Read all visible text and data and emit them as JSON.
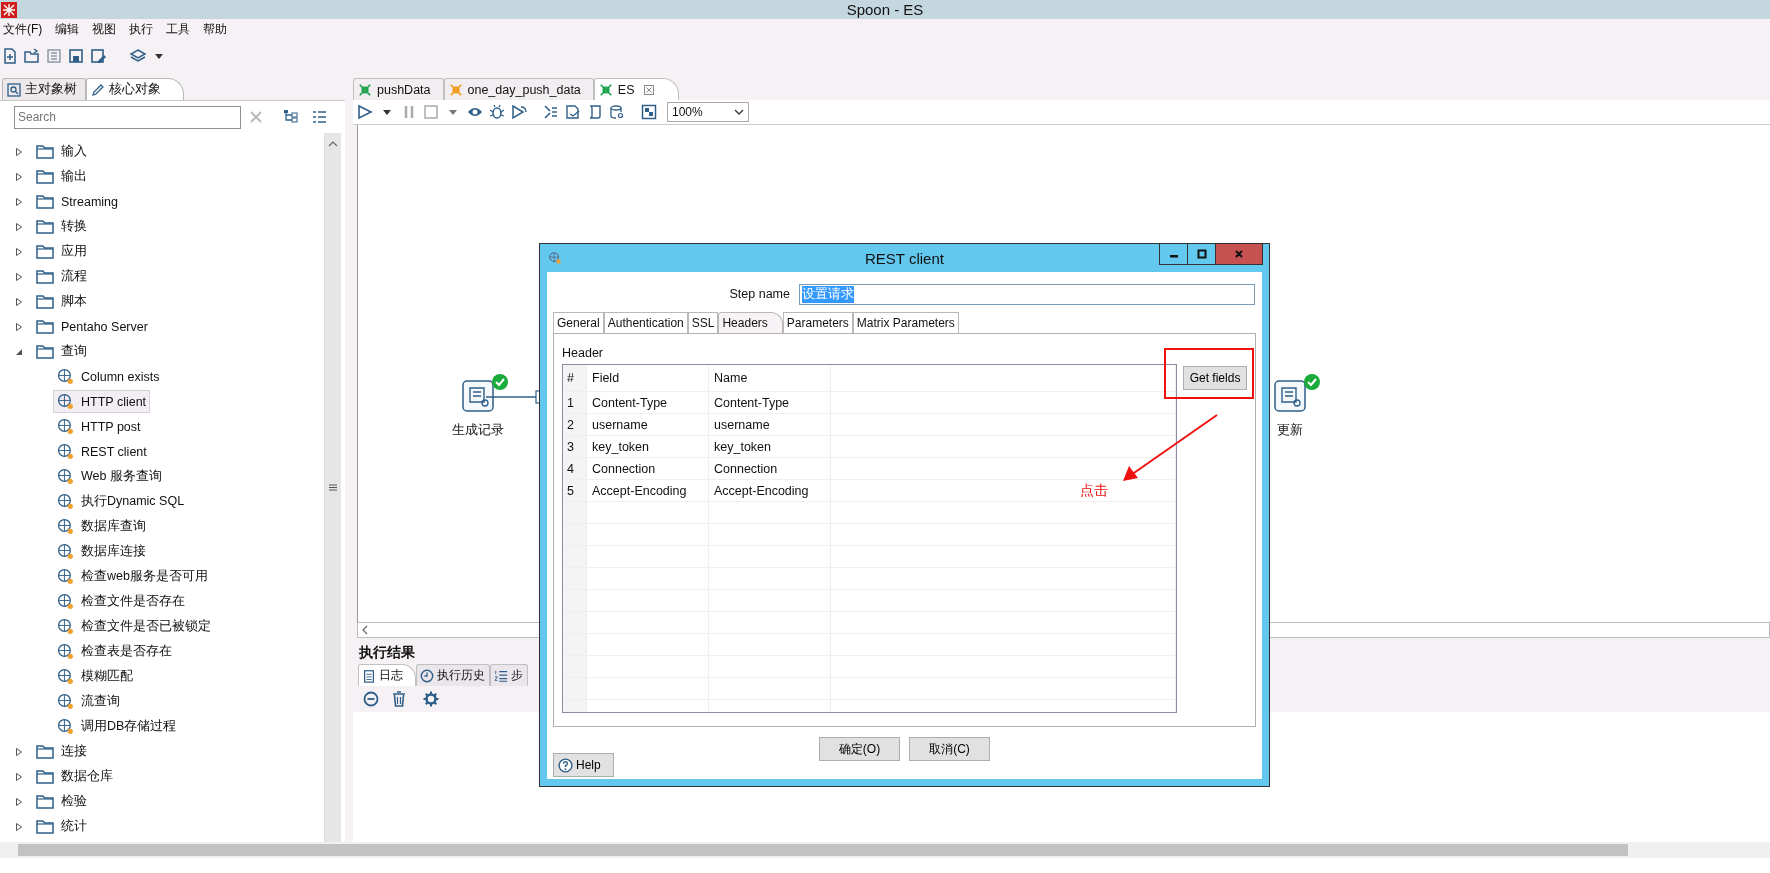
{
  "window": {
    "title": "Spoon - ES"
  },
  "menu": [
    {
      "label": "文件(F)"
    },
    {
      "label": "编辑"
    },
    {
      "label": "视图"
    },
    {
      "label": "执行"
    },
    {
      "label": "工具"
    },
    {
      "label": "帮助"
    }
  ],
  "left_panel": {
    "tabs": [
      {
        "label": "主对象树",
        "selected": false
      },
      {
        "label": "核心对象",
        "selected": true
      }
    ],
    "search": {
      "placeholder": "Search"
    },
    "tree": [
      {
        "label": "输入",
        "expanded": false,
        "selected": false
      },
      {
        "label": "输出",
        "expanded": false,
        "selected": false
      },
      {
        "label": "Streaming",
        "expanded": false,
        "selected": false
      },
      {
        "label": "转换",
        "expanded": false,
        "selected": false
      },
      {
        "label": "应用",
        "expanded": false,
        "selected": false
      },
      {
        "label": "流程",
        "expanded": false,
        "selected": false
      },
      {
        "label": "脚本",
        "expanded": false,
        "selected": false
      },
      {
        "label": "Pentaho Server",
        "expanded": false,
        "selected": false
      },
      {
        "label": "查询",
        "expanded": true,
        "selected": false,
        "children": [
          {
            "label": "Column exists",
            "selected": false
          },
          {
            "label": "HTTP client",
            "selected": true
          },
          {
            "label": "HTTP post",
            "selected": false
          },
          {
            "label": "REST client",
            "selected": false
          },
          {
            "label": "Web 服务查询",
            "selected": false
          },
          {
            "label": "执行Dynamic SQL",
            "selected": false
          },
          {
            "label": "数据库查询",
            "selected": false
          },
          {
            "label": "数据库连接",
            "selected": false
          },
          {
            "label": "检查web服务是否可用",
            "selected": false
          },
          {
            "label": "检查文件是否存在",
            "selected": false
          },
          {
            "label": "检查文件是否已被锁定",
            "selected": false
          },
          {
            "label": "检查表是否存在",
            "selected": false
          },
          {
            "label": "模糊匹配",
            "selected": false
          },
          {
            "label": "流查询",
            "selected": false
          },
          {
            "label": "调用DB存储过程",
            "selected": false
          }
        ]
      },
      {
        "label": "连接",
        "expanded": false,
        "selected": false
      },
      {
        "label": "数据仓库",
        "expanded": false,
        "selected": false
      },
      {
        "label": "检验",
        "expanded": false,
        "selected": false
      },
      {
        "label": "统计",
        "expanded": false,
        "selected": false
      }
    ]
  },
  "editor_tabs": [
    {
      "label": "pushData",
      "kind": "transformation",
      "selected": false
    },
    {
      "label": "one_day_push_data",
      "kind": "job",
      "selected": false
    },
    {
      "label": "ES",
      "kind": "transformation",
      "selected": true
    }
  ],
  "zoom": {
    "value": "100%"
  },
  "canvas": {
    "nodes": [
      {
        "label": "生成记录",
        "ok": true
      },
      {
        "label": "更新",
        "ok": true
      }
    ]
  },
  "results": {
    "title": "执行结果",
    "tabs": [
      {
        "label": "日志",
        "selected": true
      },
      {
        "label": "执行历史",
        "selected": false
      },
      {
        "label": "步",
        "selected": false
      }
    ]
  },
  "dialog": {
    "title": "REST client",
    "step_name_label": "Step name",
    "step_name": "设置请求",
    "step_name_highlighted": true,
    "tabs": [
      {
        "label": "General",
        "selected": false
      },
      {
        "label": "Authentication",
        "selected": false
      },
      {
        "label": "SSL",
        "selected": false
      },
      {
        "label": "Headers",
        "selected": true
      },
      {
        "label": "Parameters",
        "selected": false
      },
      {
        "label": "Matrix Parameters",
        "selected": false
      }
    ],
    "section_label": "Header",
    "table": {
      "columns": [
        "#",
        "Field",
        "Name"
      ],
      "rows": [
        {
          "num": "1",
          "field": "Content-Type",
          "name": "Content-Type"
        },
        {
          "num": "2",
          "field": "username",
          "name": "username"
        },
        {
          "num": "3",
          "field": "key_token",
          "name": "key_token"
        },
        {
          "num": "4",
          "field": "Connection",
          "name": "Connection"
        },
        {
          "num": "5",
          "field": "Accept-Encoding",
          "name": "Accept-Encoding"
        }
      ]
    },
    "get_fields": "Get fields",
    "annotation": "点击",
    "buttons": [
      "确定(O)",
      "取消(C)"
    ],
    "help": "Help"
  }
}
